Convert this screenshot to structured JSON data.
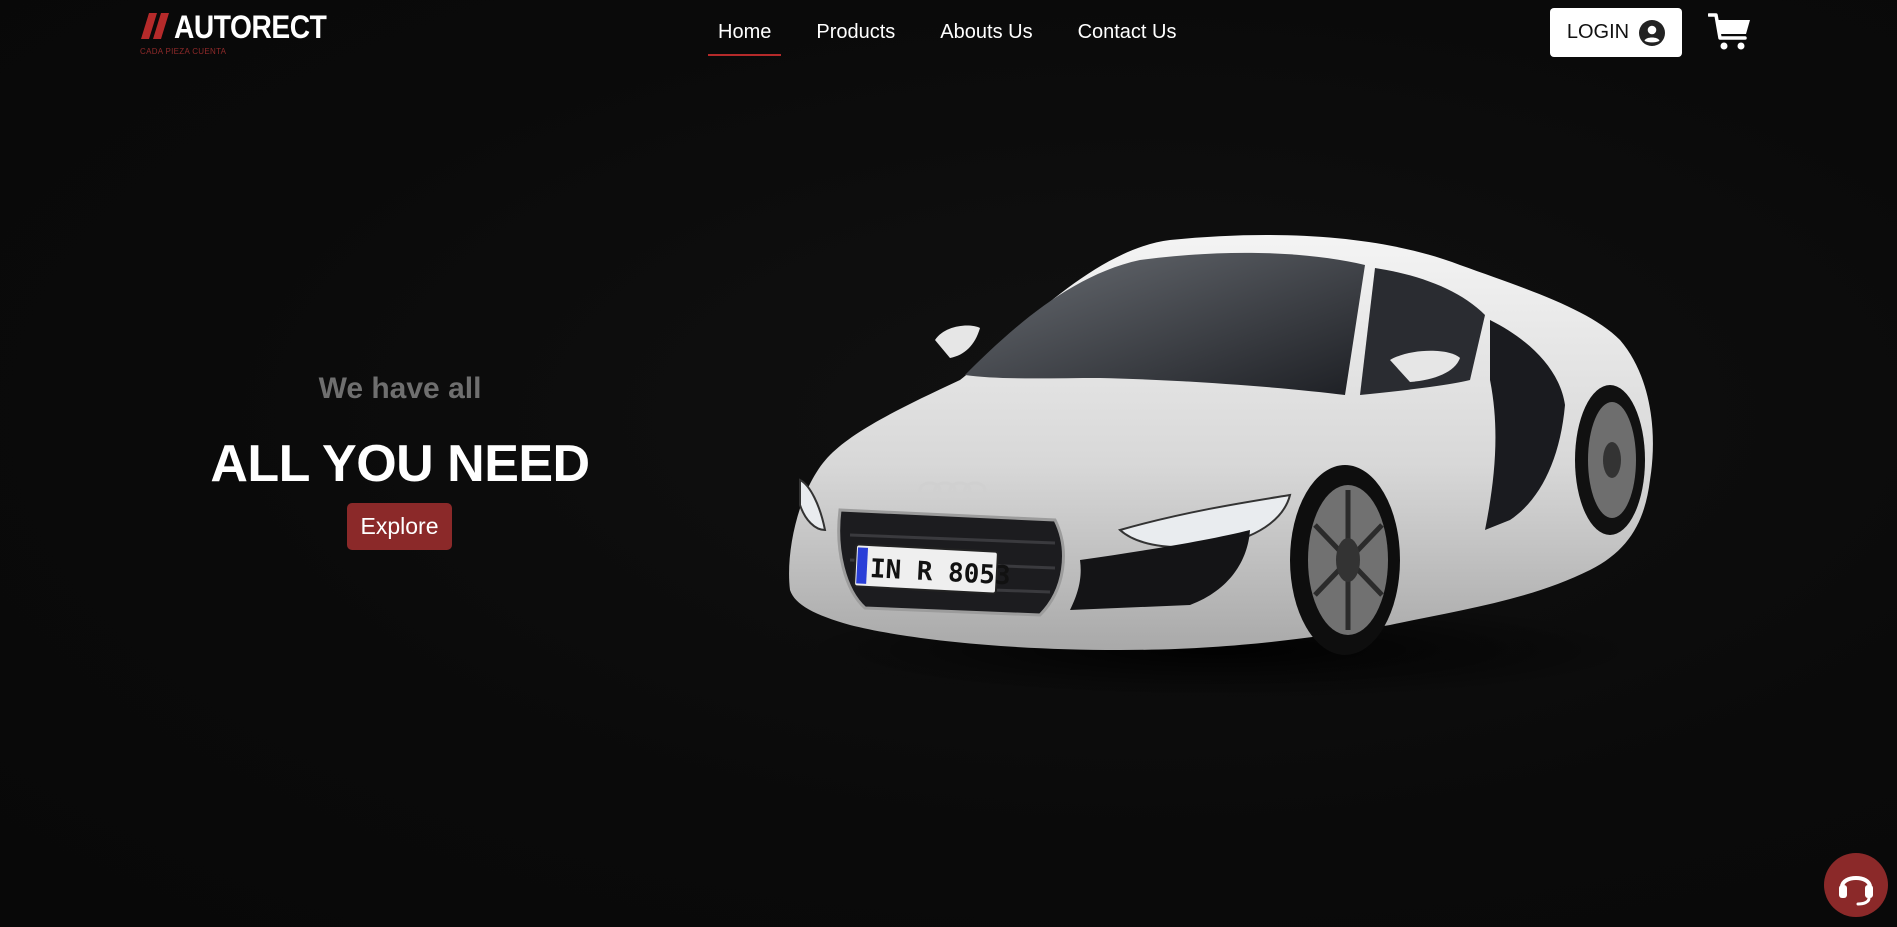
{
  "brand": {
    "name": "AUTORECT",
    "tagline": "CADA PIEZA CUENTA",
    "accent_color": "#8b2929"
  },
  "nav": {
    "items": [
      {
        "label": "Home",
        "active": true
      },
      {
        "label": "Products",
        "active": false
      },
      {
        "label": "Abouts Us",
        "active": false
      },
      {
        "label": "Contact Us",
        "active": false
      }
    ]
  },
  "header_actions": {
    "login_label": "LOGIN",
    "login_icon": "user-circle-icon",
    "cart_icon": "cart-icon"
  },
  "hero": {
    "subtitle": "We have all",
    "title": "ALL YOU NEED",
    "cta_label": "Explore",
    "license_plate": "IN R 8053"
  },
  "support": {
    "icon": "headset-icon"
  }
}
